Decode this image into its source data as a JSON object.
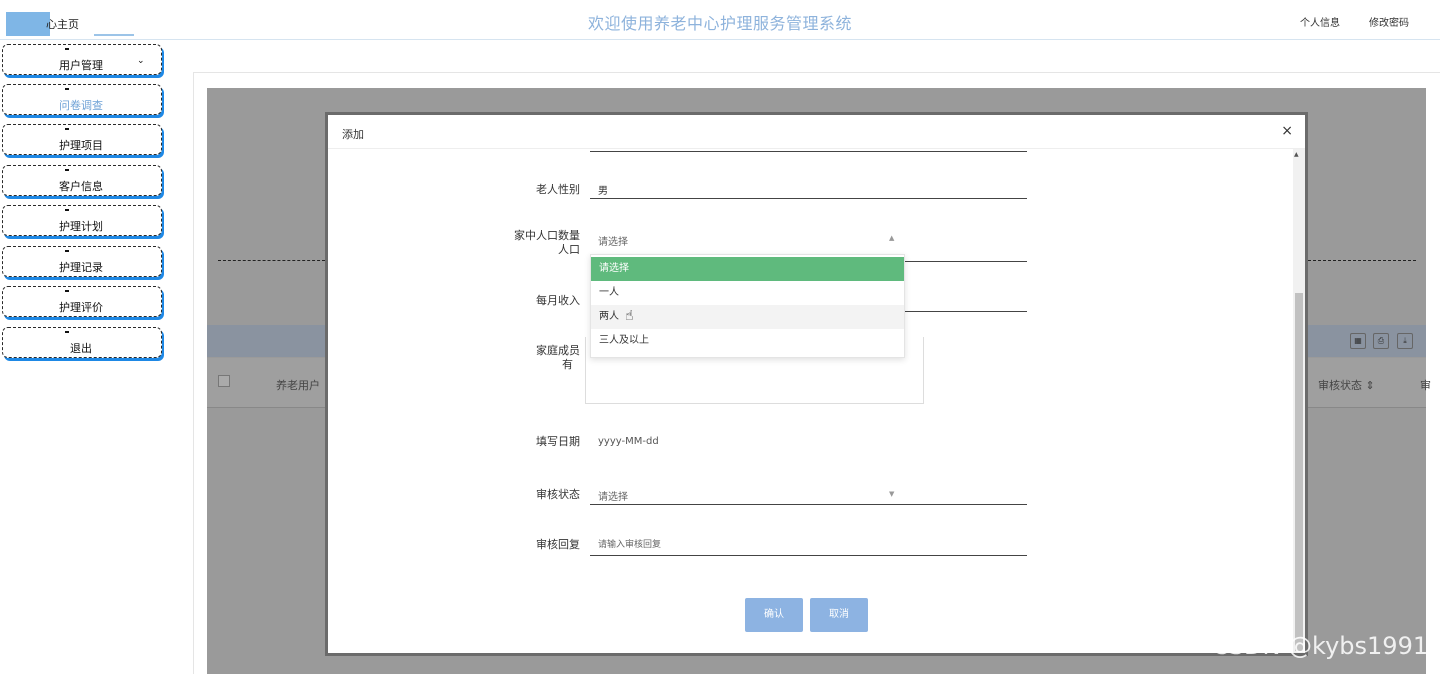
{
  "header": {
    "home_tab": "心主页",
    "title": "欢迎使用养老中心护理服务管理系统",
    "profile_link": "个人信息",
    "password_link": "修改密码"
  },
  "sidebar": {
    "items": [
      {
        "label": "用户管理",
        "has_chevron": true
      },
      {
        "label": "问卷调查",
        "active": true
      },
      {
        "label": "护理项目"
      },
      {
        "label": "客户信息"
      },
      {
        "label": "护理计划"
      },
      {
        "label": "护理记录"
      },
      {
        "label": "护理评价"
      },
      {
        "label": "退出"
      }
    ],
    "chevron_icon": "chevron-down-icon"
  },
  "background_table": {
    "col_username": "养老用户",
    "col_status": "审核状态",
    "col_extra": "审"
  },
  "modal": {
    "title": "添加",
    "close_glyph": "×",
    "fields": {
      "gender": {
        "label": "老人性别",
        "value": "男"
      },
      "household": {
        "label": "家中人口数量",
        "label_line2": "人口",
        "placeholder": "请选择"
      },
      "income": {
        "label": "每月收入"
      },
      "family": {
        "label": "家庭成员",
        "label_line2": "有"
      },
      "date": {
        "label": "填写日期",
        "placeholder": "yyyy-MM-dd"
      },
      "review_status": {
        "label": "审核状态",
        "placeholder": "请选择"
      },
      "review_reply": {
        "label": "审核回复",
        "placeholder": "请输入审核回复"
      }
    },
    "dropdown": {
      "options": [
        "请选择",
        "一人",
        "两人",
        "三人及以上"
      ],
      "selected_color": "#5fba7d"
    },
    "buttons": {
      "confirm": "确认",
      "cancel": "取消"
    }
  },
  "watermark": "CSDN @kybs1991"
}
